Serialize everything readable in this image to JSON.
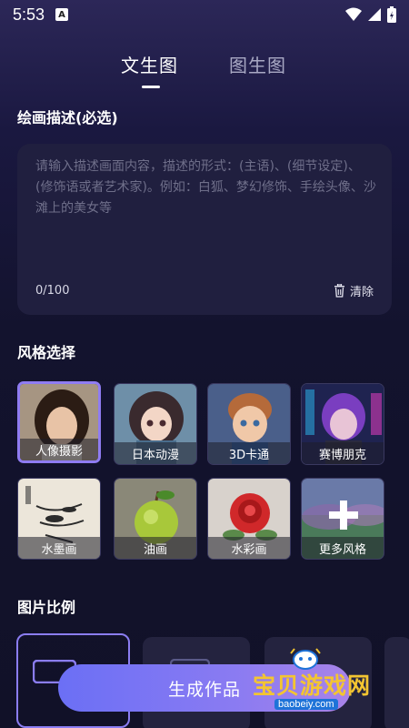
{
  "status_bar": {
    "time": "5:53",
    "app_icon": "A"
  },
  "tabs": [
    {
      "label": "文生图",
      "active": true
    },
    {
      "label": "图生图",
      "active": false
    }
  ],
  "description": {
    "title": "绘画描述(必选)",
    "placeholder": "请输入描述画面内容，描述的形式：(主语)、(细节设定)、(修饰语或者艺术家)。例如：白狐、梦幻修饰、手绘头像、沙滩上的美女等",
    "count": "0/100",
    "clear_label": "清除"
  },
  "style": {
    "title": "风格选择",
    "items": [
      {
        "label": "人像摄影",
        "selected": true
      },
      {
        "label": "日本动漫",
        "selected": false
      },
      {
        "label": "3D卡通",
        "selected": false
      },
      {
        "label": "赛博朋克",
        "selected": false
      },
      {
        "label": "水墨画",
        "selected": false
      },
      {
        "label": "油画",
        "selected": false
      },
      {
        "label": "水彩画",
        "selected": false
      },
      {
        "label": "更多风格",
        "selected": false
      }
    ]
  },
  "ratio": {
    "title": "图片比例"
  },
  "generate_button": {
    "label": "生成作品"
  },
  "watermark": {
    "text": "宝贝游戏网",
    "url": "baobeiy.com"
  },
  "colors": {
    "accent": "#8f7cf2",
    "background": "#13132e",
    "button_start": "#6b6ff5",
    "button_end": "#a883e8"
  }
}
